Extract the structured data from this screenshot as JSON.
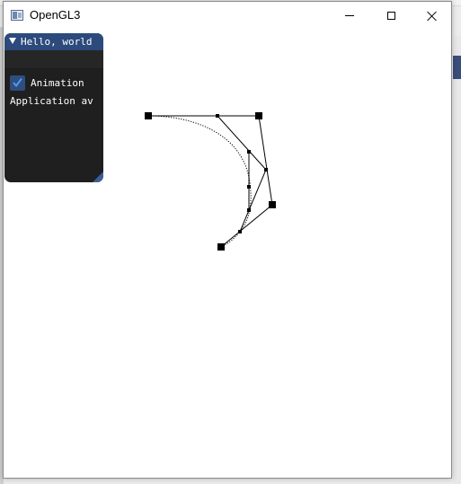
{
  "window": {
    "title": "OpenGL3"
  },
  "colors": {
    "imgui_title_bg": "#2c4a7c",
    "imgui_bg": "#1f1f1f",
    "checkbox_bg": "#2f4d7d",
    "checkmark": "#4a9af2",
    "control_point": "#000000"
  },
  "imgui_panel": {
    "title": "Hello, world",
    "checkbox_label": "Animation",
    "checked": true,
    "text": "Application av"
  },
  "icons": {
    "app": "window-app-icon",
    "minimize": "minimize-icon",
    "maximize": "maximize-icon",
    "close": "close-icon",
    "collapse": "triangle-down-icon",
    "check": "checkmark-icon",
    "grip": "resize-grip-icon"
  }
}
